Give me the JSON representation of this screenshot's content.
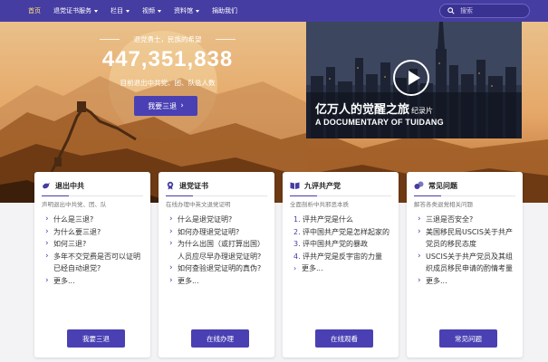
{
  "nav": {
    "items": [
      "首页",
      "退党证书服务",
      "栏目",
      "视频",
      "资料馆",
      "捐助我们"
    ],
    "search_placeholder": "搜索"
  },
  "hero": {
    "tagline": "退党勇士，民族的希望",
    "count": "447,351,838",
    "subtitle": "目前退出中共党、团、队总人数",
    "button": "我要三退"
  },
  "video": {
    "title": "亿万人的觉醒之旅",
    "title_tag": "纪录片",
    "subtitle": "A DOCUMENTARY OF TUIDANG"
  },
  "cards": [
    {
      "title": "退出中共",
      "subtitle": "声明退出中共党、团、队",
      "items": [
        "什么是三退?",
        "为什么要三退?",
        "如何三退?",
        "多年不交党费是否可以证明已经自动退党?",
        "更多..."
      ],
      "button": "我要三退"
    },
    {
      "title": "退党证书",
      "subtitle": "在线办理中英文退党证明",
      "items": [
        "什么是退党证明?",
        "如何办理退党证明?",
        "为什么出国（或打算出国）人员应尽早办理退党证明?",
        "如何查验退党证明的真伪?",
        "更多..."
      ],
      "button": "在线办理"
    },
    {
      "title": "九评共产党",
      "subtitle": "全面剖析中共邪恶本质",
      "items": [
        "评共产党是什么",
        "评中国共产党是怎样起家的",
        "评中国共产党的暴政",
        "评共产党是反宇宙的力量",
        "更多..."
      ],
      "button": "在线观看"
    },
    {
      "title": "常见问题",
      "subtitle": "解答各类退党相关问题",
      "items": [
        "三退是否安全?",
        "美国移民局USCIS关于共产党员的移民态度",
        "USCIS关于共产党员及其组织成员移民申请的酌情考量",
        "更多..."
      ],
      "button": "常见问题"
    }
  ],
  "colors": {
    "nav_bg": "#463da3",
    "accent": "#4a40b3",
    "active_nav": "#ffe27a"
  }
}
